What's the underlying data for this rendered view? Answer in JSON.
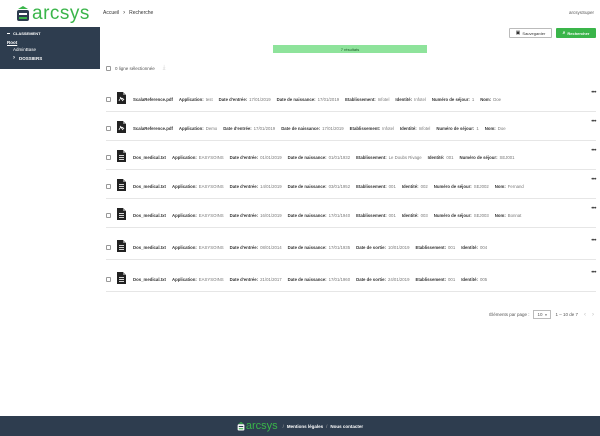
{
  "header": {
    "logo_text": "arcsys",
    "breadcrumb": [
      "Accueil",
      "Recherche"
    ],
    "user": "arcsysSuper"
  },
  "sidebar": {
    "title": "CLASSEMENT",
    "root": "Root",
    "admin": "Admin​Base",
    "dossiers": "DOSSIERS"
  },
  "toolbar": {
    "save_label": "Sauvegarder",
    "search_label": "Rechercher"
  },
  "results_label": "7 résultats",
  "select_label": "0 ligne sélectionnée",
  "rows": [
    {
      "type": "pdf",
      "fields": [
        {
          "v": "ScalaReference.pdf",
          "fname": true
        },
        {
          "k": "Application:",
          "v": "test"
        },
        {
          "k": "Date d'entrée:",
          "v": "17/01/2019"
        },
        {
          "k": "Date de naissance:",
          "v": "17/01/2019"
        },
        {
          "k": "Etablissement:",
          "v": "Infotel"
        },
        {
          "k": "Identité:",
          "v": "Infotel"
        },
        {
          "k": "Numéro de séjour:",
          "v": "1"
        },
        {
          "k": "Nom:",
          "v": "Doe"
        }
      ]
    },
    {
      "type": "pdf",
      "fields": [
        {
          "v": "ScalaReference.pdf",
          "fname": true
        },
        {
          "k": "Application:",
          "v": "Demo"
        },
        {
          "k": "Date d'entrée:",
          "v": "17/01/2019"
        },
        {
          "k": "Date de naissance:",
          "v": "17/01/2019"
        },
        {
          "k": "Etablissement:",
          "v": "Infotel"
        },
        {
          "k": "Identité:",
          "v": "Infotel"
        },
        {
          "k": "Numéro de séjour:",
          "v": "1"
        },
        {
          "k": "Nom:",
          "v": "Doe"
        }
      ]
    },
    {
      "type": "txt",
      "fields": [
        {
          "v": "Dos_medical.txt",
          "fname": true
        },
        {
          "k": "Application:",
          "v": "EASYSOINS"
        },
        {
          "k": "Date d'entrée:",
          "v": "01/01/2019"
        },
        {
          "k": "Date de naissance:",
          "v": "01/01/1932"
        },
        {
          "k": "Etablissement:",
          "v": "Le Doubs Rivage"
        },
        {
          "k": "Identité:",
          "v": "001"
        },
        {
          "k": "Numéro de séjour:",
          "v": "SEJ001"
        }
      ]
    },
    {
      "type": "txt",
      "fields": [
        {
          "v": "Dos_medical.txt",
          "fname": true
        },
        {
          "k": "Application:",
          "v": "EASYSOINS"
        },
        {
          "k": "Date d'entrée:",
          "v": "14/01/2019"
        },
        {
          "k": "Date de naissance:",
          "v": "03/01/1952"
        },
        {
          "k": "Etablissement:",
          "v": "001"
        },
        {
          "k": "Identité:",
          "v": "002"
        },
        {
          "k": "Numéro de séjour:",
          "v": "SEJ002"
        },
        {
          "k": "Nom:",
          "v": "Fernand"
        }
      ]
    },
    {
      "type": "txt",
      "fields": [
        {
          "v": "Dos_medical.txt",
          "fname": true
        },
        {
          "k": "Application:",
          "v": "EASYSOINS"
        },
        {
          "k": "Date d'entrée:",
          "v": "16/01/2019"
        },
        {
          "k": "Date de naissance:",
          "v": "17/01/1940"
        },
        {
          "k": "Etablissement:",
          "v": "001"
        },
        {
          "k": "Identité:",
          "v": "003"
        },
        {
          "k": "Numéro de séjour:",
          "v": "SEJ003"
        },
        {
          "k": "Nom:",
          "v": "Bonnat"
        }
      ]
    },
    {
      "type": "txt",
      "fields": [
        {
          "v": "Dos_medical.txt",
          "fname": true
        },
        {
          "k": "Application:",
          "v": "EASYSOINS"
        },
        {
          "k": "Date d'entrée:",
          "v": "08/01/2014"
        },
        {
          "k": "Date de naissance:",
          "v": "17/01/1935"
        },
        {
          "k": "Date de sortie:",
          "v": "10/01/2019"
        },
        {
          "k": "Etablissement:",
          "v": "001"
        },
        {
          "k": "Identité:",
          "v": "004"
        }
      ]
    },
    {
      "type": "txt",
      "fields": [
        {
          "v": "Dos_medical.txt",
          "fname": true
        },
        {
          "k": "Application:",
          "v": "EASYSOINS"
        },
        {
          "k": "Date d'entrée:",
          "v": "21/01/2017"
        },
        {
          "k": "Date de naissance:",
          "v": "17/01/1960"
        },
        {
          "k": "Date de sortie:",
          "v": "24/01/2019"
        },
        {
          "k": "Etablissement:",
          "v": "001"
        },
        {
          "k": "Identité:",
          "v": "005"
        }
      ]
    }
  ],
  "pager": {
    "label": "Éléments par page :",
    "per_page": "10",
    "range": "1 – 10 de 7"
  },
  "footer": {
    "logo_text": "arcsys",
    "links": [
      "Mentions légales",
      "Nous contacter"
    ]
  },
  "colors": {
    "accent": "#3ab54a",
    "navy": "#2e3d4f",
    "results_bg": "#8ee39b"
  }
}
